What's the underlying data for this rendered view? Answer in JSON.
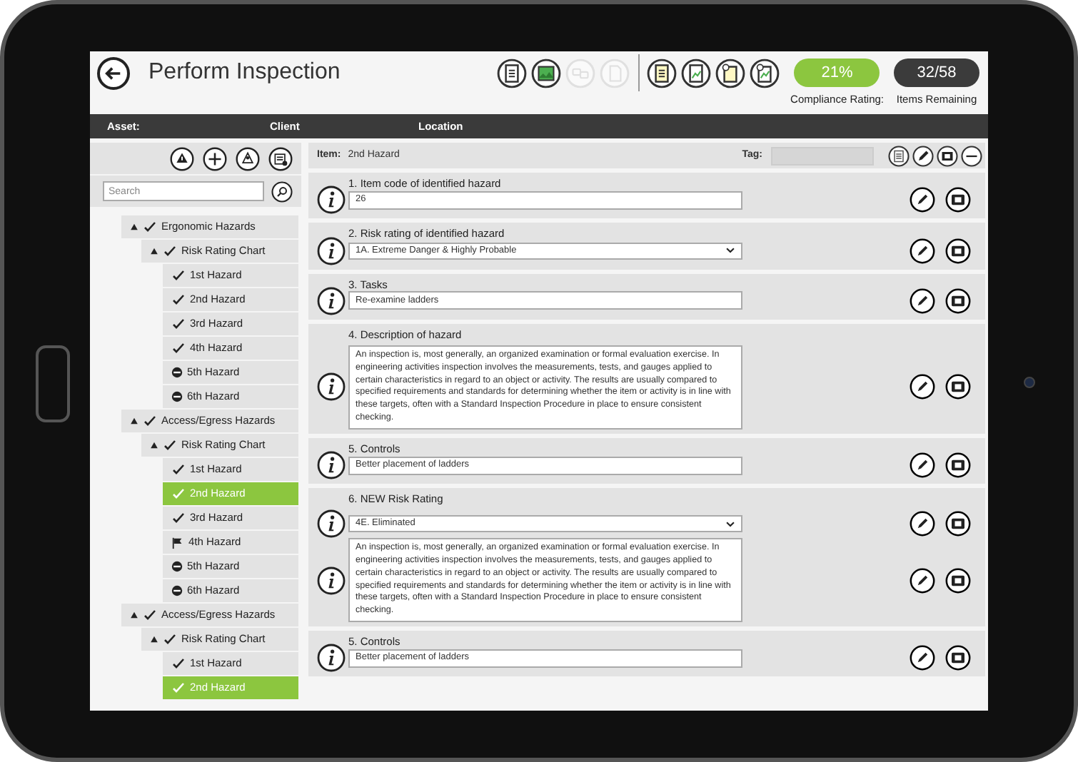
{
  "header": {
    "title": "Perform Inspection",
    "toolbar": [
      {
        "disabled": false
      },
      {
        "disabled": false
      },
      {
        "disabled": true
      },
      {
        "disabled": true
      },
      {
        "disabled": false
      },
      {
        "disabled": false
      },
      {
        "disabled": false
      },
      {
        "disabled": false
      }
    ],
    "compliance": {
      "value": "21%",
      "label": "Compliance Rating:"
    },
    "remaining": {
      "value": "32/58",
      "label": "Items Remaining"
    }
  },
  "info_bar": [
    "Asset:",
    "Client",
    "Location"
  ],
  "sidebar": {
    "search": {
      "placeholder": "Search"
    },
    "tree": [
      {
        "label": "Ergonomic Hazards",
        "kind": "check",
        "expanded": true,
        "selected": false,
        "children": [
          {
            "label": "Risk Rating Chart",
            "kind": "check",
            "expanded": true,
            "selected": false,
            "children": [
              {
                "label": "1st Hazard",
                "kind": "check",
                "selected": false
              },
              {
                "label": "2nd Hazard",
                "kind": "check",
                "selected": false
              },
              {
                "label": "3rd Hazard",
                "kind": "check",
                "selected": false
              },
              {
                "label": "4th Hazard",
                "kind": "check",
                "selected": false
              },
              {
                "label": "5th Hazard",
                "kind": "minus",
                "selected": false
              },
              {
                "label": "6th Hazard",
                "kind": "minus",
                "selected": false
              }
            ]
          }
        ]
      },
      {
        "label": "Access/Egress Hazards",
        "kind": "check",
        "expanded": true,
        "selected": false,
        "children": [
          {
            "label": "Risk Rating Chart",
            "kind": "check",
            "expanded": true,
            "selected": false,
            "children": [
              {
                "label": "1st Hazard",
                "kind": "check",
                "selected": false
              },
              {
                "label": "2nd Hazard",
                "kind": "check",
                "selected": true
              },
              {
                "label": "3rd Hazard",
                "kind": "check",
                "selected": false
              },
              {
                "label": "4th Hazard",
                "kind": "flag",
                "selected": false
              },
              {
                "label": "5th Hazard",
                "kind": "minus",
                "selected": false
              },
              {
                "label": "6th Hazard",
                "kind": "minus",
                "selected": false
              }
            ]
          }
        ]
      },
      {
        "label": "Access/Egress Hazards",
        "kind": "check",
        "expanded": true,
        "selected": false,
        "children": [
          {
            "label": "Risk Rating Chart",
            "kind": "check",
            "expanded": true,
            "selected": false,
            "children": [
              {
                "label": "1st Hazard",
                "kind": "check",
                "selected": false
              },
              {
                "label": "2nd Hazard",
                "kind": "check",
                "selected": true
              }
            ]
          }
        ]
      }
    ]
  },
  "item": {
    "label": "Item:",
    "value": "2nd Hazard",
    "tag_label": "Tag:"
  },
  "questions": [
    {
      "label": "1. Item code of identified hazard",
      "fields": [
        {
          "kind": "text",
          "value": "26"
        }
      ]
    },
    {
      "label": "2. Risk rating of identified hazard",
      "fields": [
        {
          "kind": "select",
          "value": "1A. Extreme Danger & Highly Probable"
        }
      ]
    },
    {
      "label": "3. Tasks",
      "fields": [
        {
          "kind": "text",
          "value": "Re-examine ladders"
        }
      ]
    },
    {
      "label": "4. Description of hazard",
      "fields": [
        {
          "kind": "textarea",
          "value": "An inspection is, most generally, an organized examination or formal evaluation exercise. In engineering activities inspection involves the measurements, tests, and gauges applied to certain characteristics in regard to an object or activity. The results are usually compared to specified requirements and standards for determining whether the item or activity is in line with these targets, often with a Standard Inspection Procedure in place to ensure consistent checking."
        }
      ]
    },
    {
      "label": "5. Controls",
      "fields": [
        {
          "kind": "text",
          "value": "Better placement of ladders"
        }
      ]
    },
    {
      "label": "6. NEW Risk Rating",
      "fields": [
        {
          "kind": "select",
          "value": "4E. Eliminated"
        },
        {
          "kind": "textarea",
          "value": "An inspection is, most generally, an organized examination or formal evaluation exercise. In engineering activities inspection involves the measurements, tests, and gauges applied to certain characteristics in regard to an object or activity. The results are usually compared to specified requirements and standards for determining whether the item or activity is in line with these targets, often with a Standard Inspection Procedure in place to ensure consistent checking."
        }
      ]
    },
    {
      "label": "5. Controls",
      "fields": [
        {
          "kind": "text",
          "value": "Better placement of ladders"
        }
      ]
    }
  ]
}
